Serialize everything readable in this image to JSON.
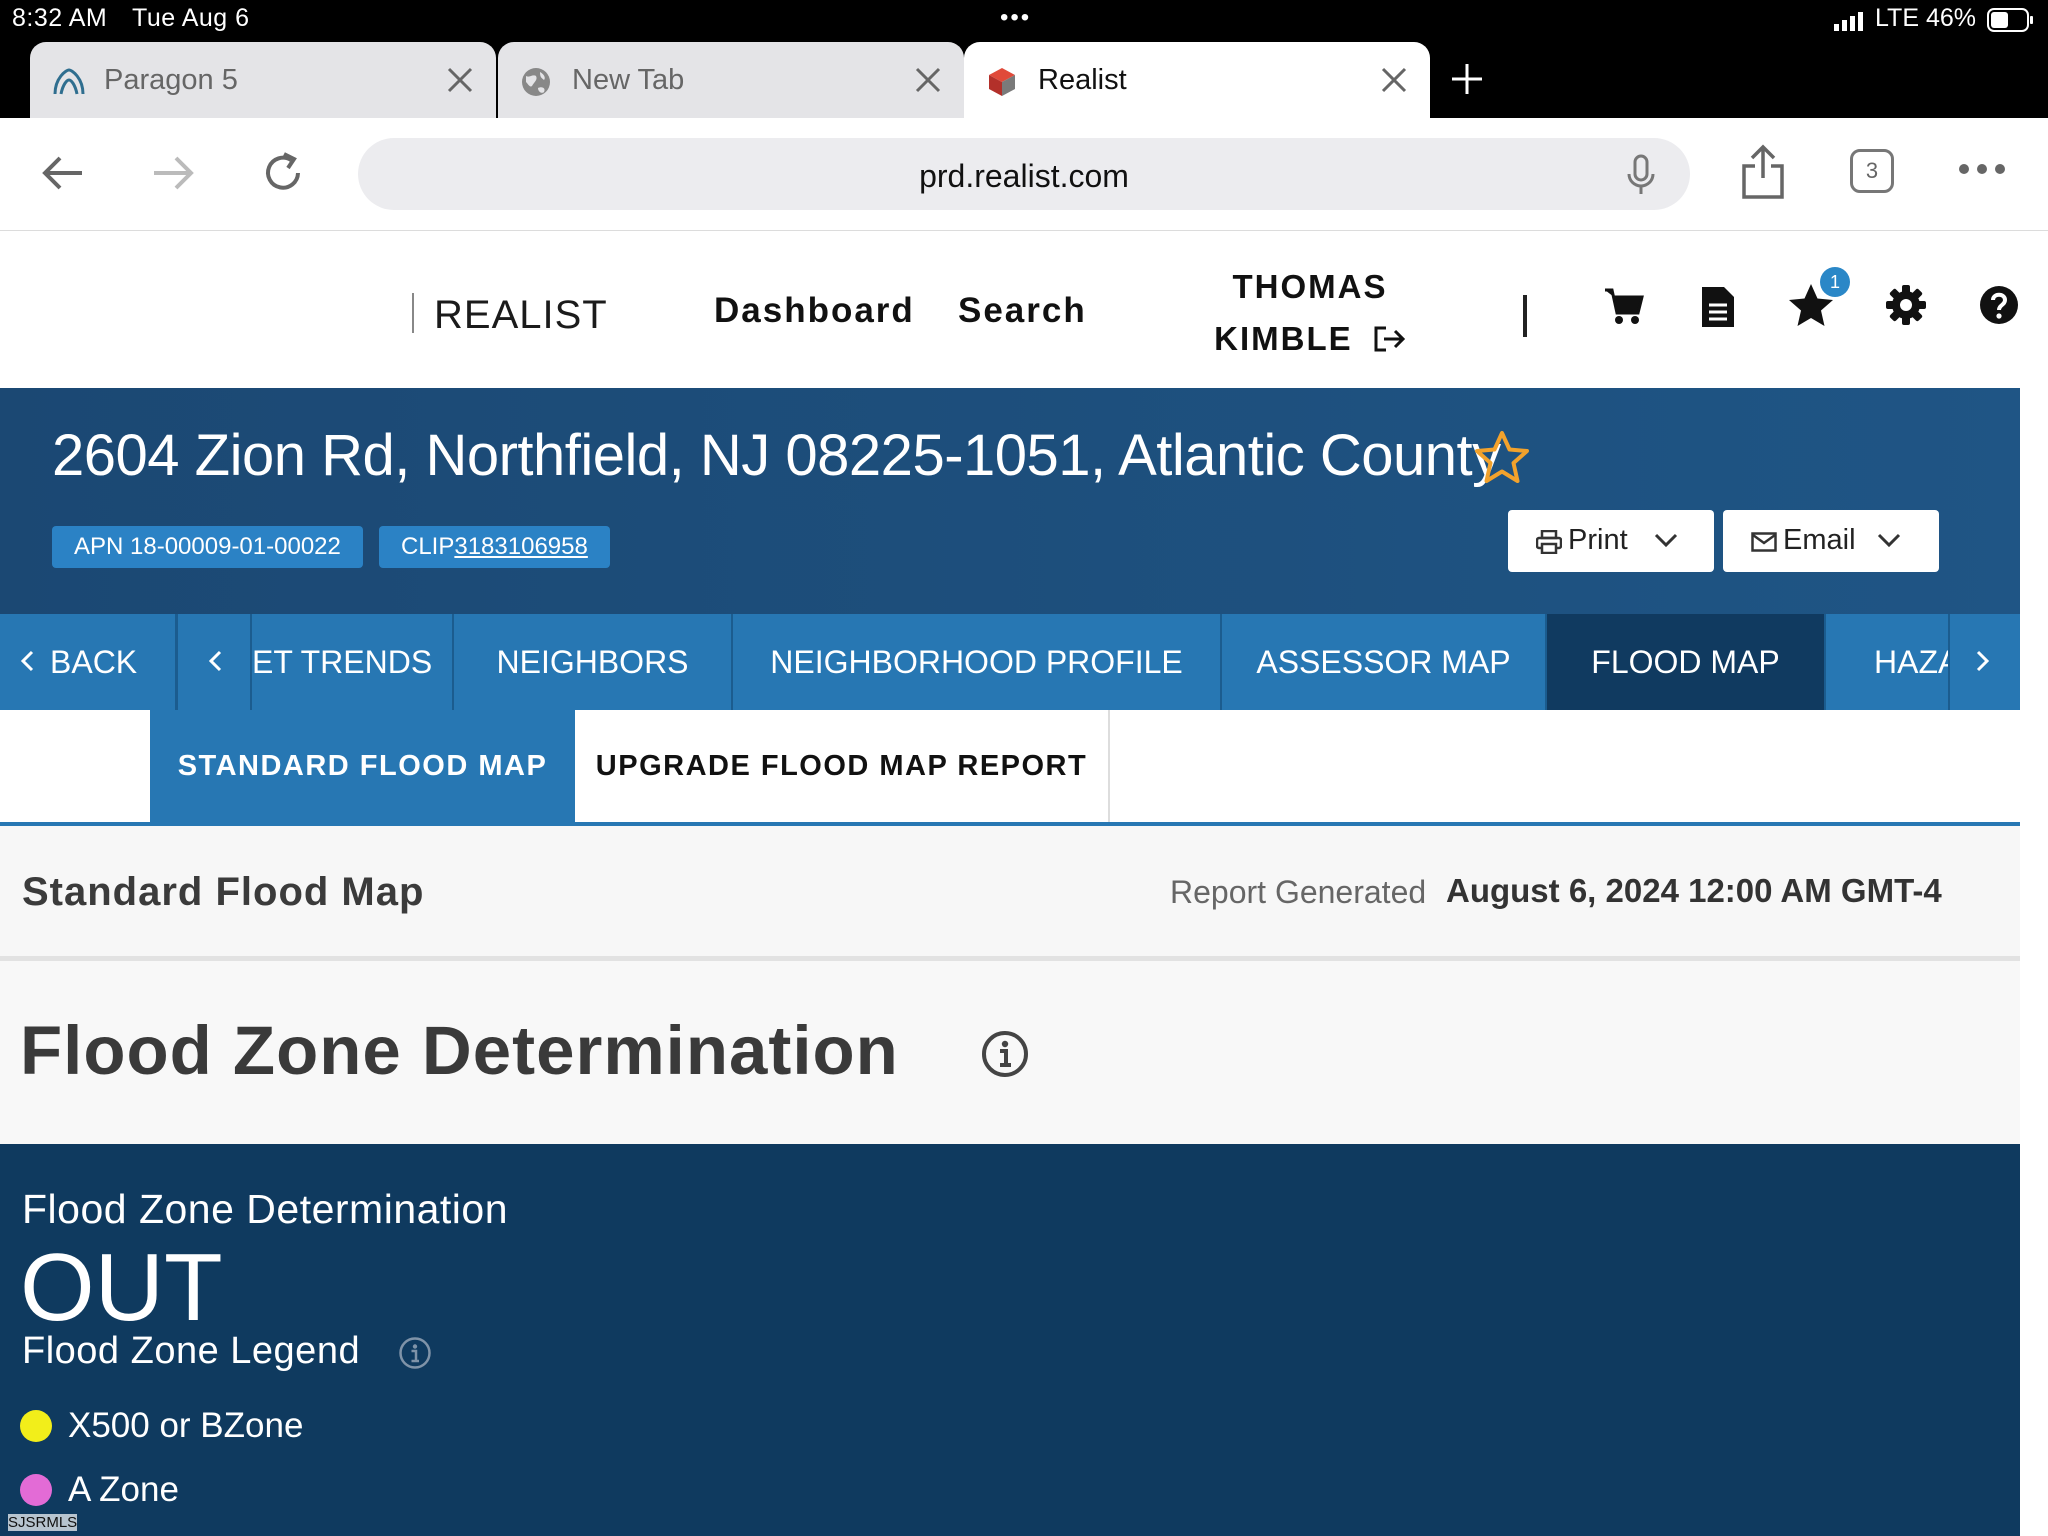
{
  "status_bar": {
    "time": "8:32 AM",
    "date": "Tue Aug 6",
    "network": "LTE",
    "battery": "46%"
  },
  "browser": {
    "tabs": [
      {
        "title": "Paragon 5",
        "icon": "paragon-icon"
      },
      {
        "title": "New Tab",
        "icon": "globe-icon"
      },
      {
        "title": "Realist",
        "icon": "realist-logo-icon",
        "active": true
      }
    ],
    "url": "prd.realist.com",
    "tab_count": "3"
  },
  "site_header": {
    "brand": "REALIST",
    "nav": [
      "Dashboard",
      "Search"
    ],
    "user_first": "THOMAS",
    "user_last": "KIMBLE",
    "favorites_badge": "1",
    "icons": [
      "cart-icon",
      "document-icon",
      "star-icon",
      "gear-icon",
      "help-icon"
    ]
  },
  "property": {
    "address": "2604 Zion Rd, Northfield, NJ 08225-1051, Atlantic County",
    "apn": "APN 18-00009-01-00022",
    "clip_prefix": "CLIP",
    "clip_number": "3183106958",
    "print_label": "Print",
    "email_label": "Email"
  },
  "section_tabs": {
    "back_label": "BACK",
    "items": [
      {
        "label": "ET TRENDS"
      },
      {
        "label": "NEIGHBORS"
      },
      {
        "label": "NEIGHBORHOOD PROFILE"
      },
      {
        "label": "ASSESSOR MAP"
      },
      {
        "label": "FLOOD MAP",
        "active": true
      },
      {
        "label": "HAZA"
      }
    ]
  },
  "sub_tabs": [
    {
      "label": "STANDARD FLOOD MAP",
      "active": true
    },
    {
      "label": "UPGRADE FLOOD MAP REPORT"
    }
  ],
  "report": {
    "title": "Standard Flood Map",
    "generated_label": "Report Generated",
    "generated_date": "August 6, 2024 12:00 AM GMT-4"
  },
  "flood": {
    "heading": "Flood Zone Determination",
    "determination_label": "Flood Zone Determination",
    "determination_value": "OUT",
    "legend_title": "Flood Zone Legend",
    "legend": [
      {
        "label": "X500 or BZone",
        "color": "#f2ee1a"
      },
      {
        "label": "A Zone",
        "color": "#e36bd6"
      }
    ]
  },
  "watermark": "SJSRMLS"
}
